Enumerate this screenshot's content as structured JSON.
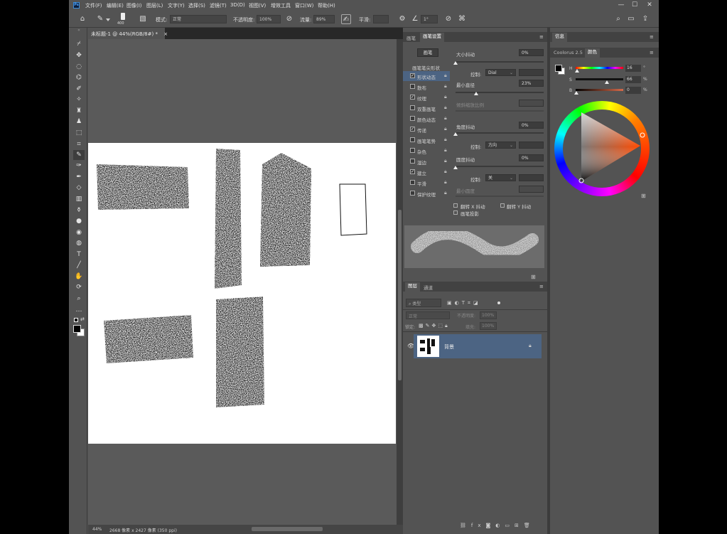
{
  "app": {
    "logo": "Ps"
  },
  "menu": [
    "文件(F)",
    "编辑(E)",
    "图像(I)",
    "图层(L)",
    "文字(Y)",
    "选择(S)",
    "滤镜(T)",
    "3D(D)",
    "视图(V)",
    "增效工具",
    "窗口(W)",
    "帮助(H)"
  ],
  "window_controls": {
    "minimize": "—",
    "maximize": "☐",
    "close": "✕"
  },
  "options_bar": {
    "brush_size": "400",
    "mode_label": "模式:",
    "mode_value": "正常",
    "opacity_label": "不透明度:",
    "opacity_value": "100%",
    "flow_label": "流量:",
    "flow_value": "89%",
    "smooth_label": "平滑:",
    "smooth_value": "",
    "angle_value": "1°"
  },
  "document": {
    "tab_title": "未标题-1 @ 44%(RGB/8#) *",
    "tab_close": "×",
    "zoom": "44%",
    "info": "2668 像素 x 2427 像素 (350 ppi)"
  },
  "brush_panel": {
    "tabs": [
      "画笔",
      "画笔设置"
    ],
    "brushes_button": "画笔",
    "tip_shape_label": "画笔笔尖形状",
    "options": [
      {
        "label": "形状动态",
        "checked": true,
        "selected": true
      },
      {
        "label": "散布",
        "checked": false
      },
      {
        "label": "纹理",
        "checked": true
      },
      {
        "label": "双重画笔",
        "checked": false
      },
      {
        "label": "颜色动态",
        "checked": false
      },
      {
        "label": "传递",
        "checked": true
      },
      {
        "label": "画笔笔势",
        "checked": false
      },
      {
        "label": "杂色",
        "checked": false
      },
      {
        "label": "湿边",
        "checked": false
      },
      {
        "label": "建立",
        "checked": true
      },
      {
        "label": "平滑",
        "checked": false
      },
      {
        "label": "保护纹理",
        "checked": false
      }
    ],
    "size_jitter_label": "大小抖动",
    "size_jitter_value": "0%",
    "size_jitter_fraction": 0,
    "control_label": "控制:",
    "control1_value": "Dial",
    "min_diameter_label": "最小直径",
    "min_diameter_value": "23%",
    "min_diameter_fraction": 0.23,
    "tilt_scale_label": "倾斜缩放比例",
    "angle_jitter_label": "角度抖动",
    "angle_jitter_value": "0%",
    "angle_jitter_fraction": 0,
    "control2_value": "方向",
    "roundness_jitter_label": "圆度抖动",
    "roundness_jitter_value": "0%",
    "roundness_jitter_fraction": 0,
    "control3_value": "关",
    "min_roundness_label": "最小圆度",
    "flip_x_label": "翻转 X 抖动",
    "flip_y_label": "翻转 Y 抖动",
    "projection_label": "画笔投影"
  },
  "layers_panel": {
    "tabs": [
      "图层",
      "通道"
    ],
    "filter_kind": "类型",
    "blend_mode": "正常",
    "opacity_label": "不透明度:",
    "opacity_value": "100%",
    "lock_label": "锁定:",
    "fill_label": "填充:",
    "fill_value": "100%",
    "layers": [
      {
        "name": "背景",
        "locked": true,
        "visible": true
      }
    ],
    "footer_icons": [
      "link-icon",
      "fx-icon",
      "mask-icon",
      "adjustment-icon",
      "group-icon",
      "new-layer-icon",
      "trash-icon"
    ]
  },
  "color_panel": {
    "header_tab": "信息",
    "tabs": [
      "Coolorus 2.5",
      "颜色"
    ],
    "h_label": "H",
    "h_value": "16",
    "h_unit": "°",
    "s_label": "S",
    "s_value": "66",
    "s_unit": "%",
    "b_label": "B",
    "b_value": "0",
    "b_unit": "%",
    "foreground": "#000000",
    "background": "#ffffff"
  },
  "colors": {
    "accent_selected": "#4c6483",
    "panel_bg": "#535353",
    "dark_bg": "#282828"
  }
}
